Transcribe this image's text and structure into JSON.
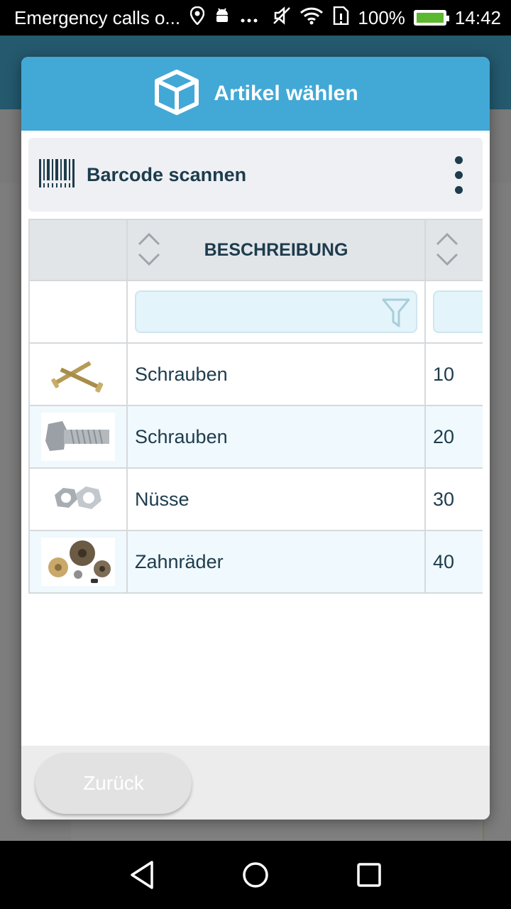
{
  "status_bar": {
    "notification_text": "Emergency calls o...",
    "battery_percent": "100%",
    "time": "14:42",
    "icons": [
      "location-icon",
      "android-icon",
      "more-icon",
      "mute-icon",
      "wifi-icon",
      "sim-icon",
      "battery-icon"
    ]
  },
  "dialog": {
    "title": "Artikel wählen",
    "title_icon": "box-icon",
    "header_color": "#42a8d6",
    "scan": {
      "label": "Barcode scannen",
      "icon": "barcode-icon"
    },
    "table": {
      "columns": [
        "",
        "BESCHREIBUNG",
        ""
      ],
      "filter_placeholder": "",
      "rows": [
        {
          "image": "screws-image",
          "description": "Schrauben",
          "number": "10"
        },
        {
          "image": "bolt-image",
          "description": "Schrauben",
          "number": "20"
        },
        {
          "image": "nuts-image",
          "description": "Nüsse",
          "number": "30"
        },
        {
          "image": "gears-image",
          "description": "Zahnräder",
          "number": "40"
        }
      ]
    },
    "back_button": "Zurück"
  },
  "colors": {
    "accent": "#42a8d6",
    "text_dark": "#1d3c4d",
    "row_alt": "#f0f9fd",
    "filter_bg": "#e4f4fb"
  }
}
